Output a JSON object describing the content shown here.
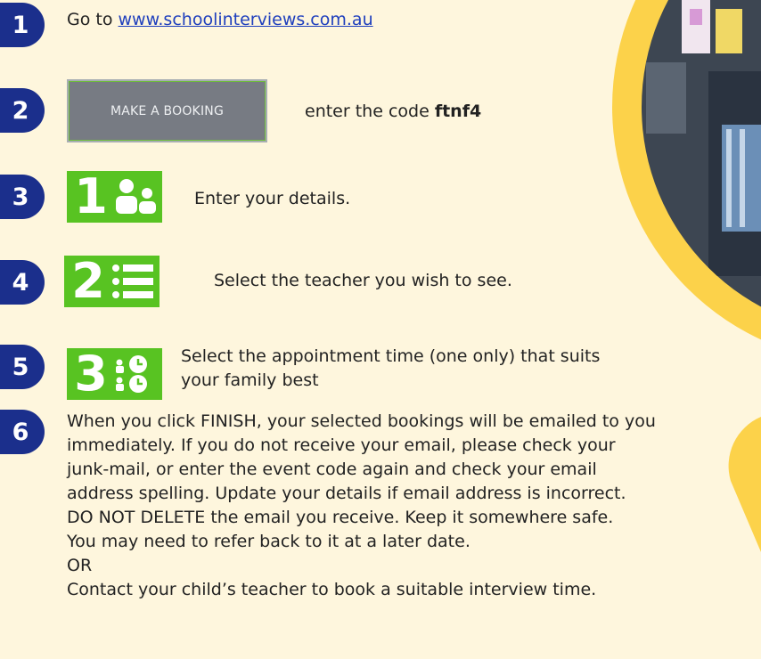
{
  "colors": {
    "background": "#fef6dd",
    "badge": "#1b2f8c",
    "accent_yellow": "#fcd24a",
    "step_icon_green": "#58c322",
    "link": "#1f3fbd"
  },
  "steps": [
    {
      "number": "1",
      "prefix": "Go to ",
      "link_text": "www.schoolinterviews.com.au"
    },
    {
      "number": "2",
      "button_label": "MAKE A BOOKING",
      "text": "enter the code ",
      "code": "ftnf4"
    },
    {
      "number": "3",
      "icon_number": "1",
      "icon": "people-icon",
      "text": "Enter your details."
    },
    {
      "number": "4",
      "icon_number": "2",
      "icon": "list-icon",
      "text": "Select the teacher you wish to see."
    },
    {
      "number": "5",
      "icon_number": "3",
      "icon": "clock-icon",
      "text_line1": "Select the appointment time (one only) that suits",
      "text_line2": "your family best"
    },
    {
      "number": "6",
      "lines": [
        "When you click FINISH, your selected bookings will be emailed to you",
        "immediately. If you do not receive your email, please check your",
        "junk-mail, or enter the event code again and check your email",
        "address spelling. Update your details if email address is incorrect.",
        "DO NOT DELETE the email you receive. Keep it somewhere safe.",
        "You may need to refer back to it at a later date.",
        "OR",
        "Contact your child’s teacher to book a suitable interview time."
      ]
    }
  ]
}
